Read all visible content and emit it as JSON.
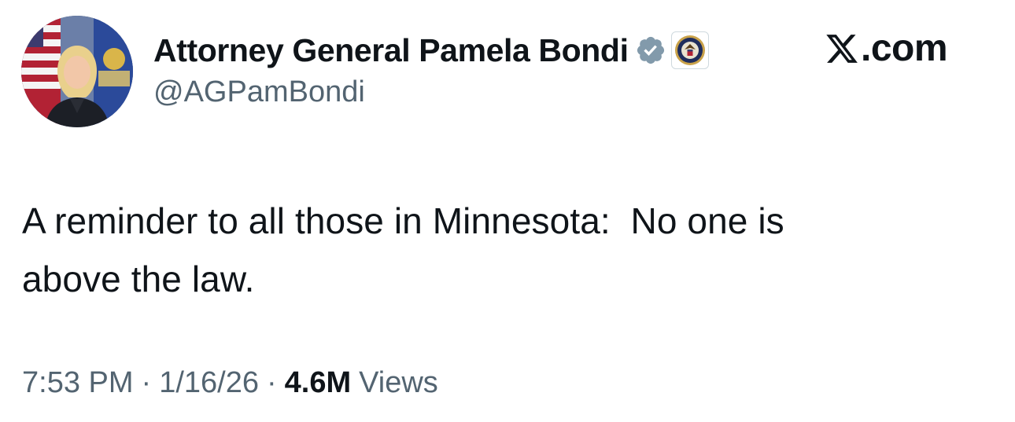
{
  "author": {
    "display_name": "Attorney General Pamela Bondi",
    "handle": "@AGPamBondi",
    "avatar_icon": "profile-photo",
    "verified_icon": "verified-badge-icon",
    "verified_color": "#829aab",
    "affiliate_icon": "doj-seal-icon"
  },
  "site": {
    "label": ".com",
    "logo_icon": "x-logo-icon"
  },
  "tweet": {
    "text": "A reminder to all those in Minnesota:  No one is\nabove the law."
  },
  "meta": {
    "time": "7:53 PM",
    "separator": "·",
    "date": "1/16/26",
    "views_count": "4.6M",
    "views_label": "Views"
  },
  "colors": {
    "text_primary": "#0f1419",
    "text_secondary": "#536471",
    "background": "#ffffff"
  }
}
